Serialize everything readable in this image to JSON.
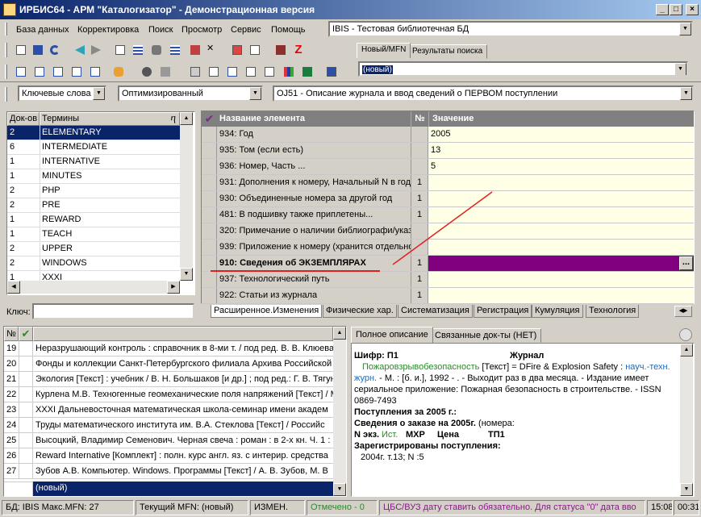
{
  "window": {
    "title": "ИРБИС64 - АРМ \"Каталогизатор\" - Демонстрационная версия"
  },
  "menu": [
    "База данных",
    "Корректировка",
    "Поиск",
    "Просмотр",
    "Сервис",
    "Помощь"
  ],
  "db_combo": "IBIS - Тестовая библиотечная БД",
  "top_tabs": [
    "Новый/MFN",
    "Результаты поиска"
  ],
  "record_combo": "(новый)",
  "search_mode": "Ключевые слова",
  "opt_mode": "Оптимизированный",
  "worksheet": "OJ51 - Описание журнала и ввод сведений о ПЕРВОМ поступлении",
  "terms": {
    "col_docs": "Док-ов",
    "col_terms": "Термины",
    "rows": [
      {
        "n": "2",
        "t": "ELEMENTARY"
      },
      {
        "n": "6",
        "t": "INTERMEDIATE"
      },
      {
        "n": "1",
        "t": "INTERNATIVE"
      },
      {
        "n": "1",
        "t": "MINUTES"
      },
      {
        "n": "2",
        "t": "PHP"
      },
      {
        "n": "2",
        "t": "PRE"
      },
      {
        "n": "1",
        "t": "REWARD"
      },
      {
        "n": "1",
        "t": "TEACH"
      },
      {
        "n": "2",
        "t": "UPPER"
      },
      {
        "n": "2",
        "t": "WINDOWS"
      },
      {
        "n": "1",
        "t": "XXXI"
      }
    ],
    "key_label": "Ключ:"
  },
  "fields": {
    "col_name": "Название элемента",
    "col_num": "№",
    "col_value": "Значение",
    "rows": [
      {
        "name": "934: Год",
        "num": "",
        "value": "2005"
      },
      {
        "name": "935: Том (если есть)",
        "num": "",
        "value": "13"
      },
      {
        "name": "936: Номер, Часть ...",
        "num": "",
        "value": "5"
      },
      {
        "name": "931: Дополнения к номеру, Начальный N в годі",
        "num": "1",
        "value": ""
      },
      {
        "name": "930: Объединенные номера за другой год",
        "num": "1",
        "value": ""
      },
      {
        "name": "481: В подшивку также приплетены...",
        "num": "1",
        "value": ""
      },
      {
        "name": "320: Примечание о наличии библиографи/указ",
        "num": "",
        "value": ""
      },
      {
        "name": "939: Приложение к номеру (хранится отдельно",
        "num": "",
        "value": ""
      },
      {
        "name": "910: Сведения  об ЭКЗЕМПЛЯРАХ",
        "num": "1",
        "value": ""
      },
      {
        "name": "937: Технологический путь",
        "num": "1",
        "value": ""
      },
      {
        "name": "922: Статьи из журнала",
        "num": "1",
        "value": ""
      }
    ]
  },
  "field_tabs": [
    "Расширенное.Изменения",
    "Физические хар.",
    "Систематизация",
    "Регистрация",
    "Кумуляция",
    "Технология"
  ],
  "results": {
    "rows": [
      {
        "n": "19",
        "t": "Неразрушающий контроль : справочник в 8-ми т. / под ред. В. В. Клюева"
      },
      {
        "n": "20",
        "t": "Фонды и коллекции Санкт-Петербургского филиала Архива Российской"
      },
      {
        "n": "21",
        "t": "Экология [Текст] : учебник / В. Н. Большаков [и др.] ; под ред.: Г. В. Тягун"
      },
      {
        "n": "22",
        "t": "Курлена М.В. Техногенные геомеханические поля напряжений [Текст] / М"
      },
      {
        "n": "23",
        "t": "XXXI Дальневосточная математическая школа-семинар имени академ"
      },
      {
        "n": "24",
        "t": "Труды математического института им. В.А. Стеклова [Текст] / Российс"
      },
      {
        "n": "25",
        "t": "Высоцкий, Владимир Семенович. Черная свеча : роман : в 2-х кн. Ч. 1 : Г"
      },
      {
        "n": "26",
        "t": "Reward Internative [Комплект] : полн. курс англ. яз. с интерир. средства"
      },
      {
        "n": "27",
        "t": "Зубов А.В. Компьютер. Windows. Программы [Текст] / А. В. Зубов, М. В"
      }
    ],
    "new_label": "(новый)",
    "col_no": "№"
  },
  "desc_tabs": [
    "Полное описание",
    "Связанные док-ты (НЕТ)"
  ],
  "desc": {
    "shifr": "Шифр: П1",
    "kind": "Журнал",
    "p1_green": "Пожаровзрывобезопасность",
    "p1_black": " [Текст] = DFire & Explosion Safety : ",
    "p1_link": "науч.-техн. журн.",
    "p1_rest": " - М. : [б. и.], 1992 -     . - Выходит раз в два месяца. - Издание имеет сериальное приложение: Пожарная безопасность в строительстве. - ISSN 0869-7493",
    "post": "Поступления за 2005 г.:",
    "order": "Сведения о заказе на 2005г.",
    "order_tail": " (номера:",
    "cols_a": "N экз.",
    "cols_b": "Ист.",
    "cols_c": "МХР",
    "cols_d": "Цена",
    "cols_e": "ТП1",
    "reg": "Зарегистрированы поступления:",
    "reg_line": "2004г. т.13; N :5"
  },
  "status": {
    "db": "БД: IBIS Макс.MFN: 27",
    "mfn": "Текущий MFN: (новый)",
    "changed": "ИЗМЕН.",
    "marked": "Отмечено - 0",
    "msg": "ЦБС/ВУЗ дату ставить обязательно. Для статуса \"0\" дата вво",
    "time1": "15:08",
    "time2": "00:31"
  },
  "colors": {
    "title_start": "#0a246a",
    "title_end": "#a6caf0",
    "select": "#0a246a",
    "purple": "#800080",
    "cream": "#ffffe6",
    "green": "#2a8a2a",
    "link": "#1e6ab8"
  }
}
